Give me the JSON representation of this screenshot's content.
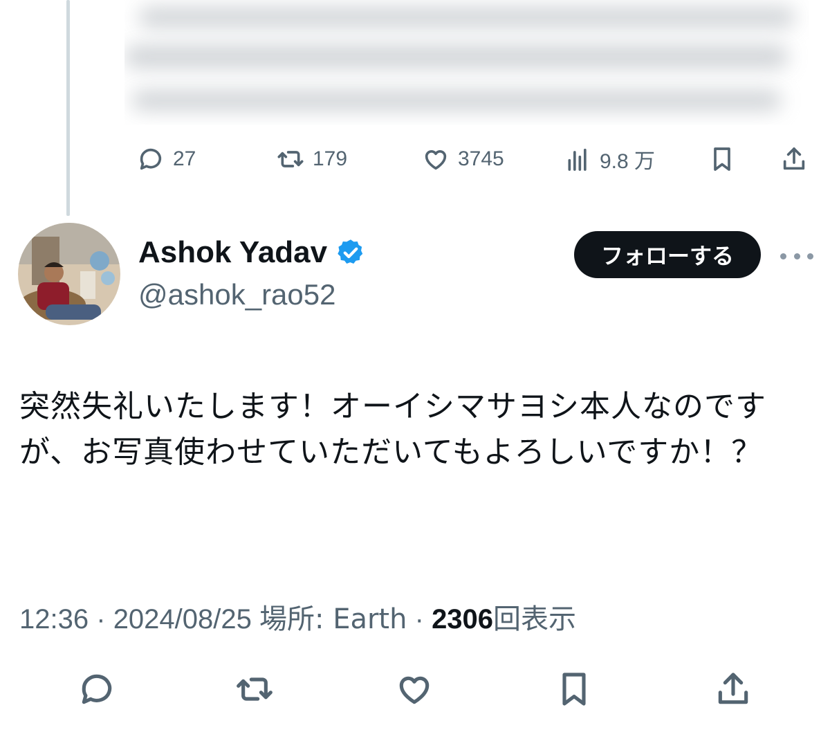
{
  "previous_tweet": {
    "actions": {
      "replies": "27",
      "retweets": "179",
      "likes": "3745",
      "views": "9.8 万"
    }
  },
  "tweet": {
    "author": {
      "display_name": "Ashok Yadav",
      "handle": "@ashok_rao52",
      "verified": true
    },
    "follow_label": "フォローする",
    "text": "突然失礼いたします！オーイシマサヨシ本人なのですが、お写真使わせていただいてもよろしいですか！？",
    "time": "12:36",
    "date": "2024/08/25",
    "location_label": "場所: Earth",
    "views_count": "2306",
    "views_label": "回表示",
    "separator": "·"
  },
  "colors": {
    "accent_verified": "#1d9bf0",
    "follow_bg": "#0f1419",
    "muted_text": "#536471"
  }
}
